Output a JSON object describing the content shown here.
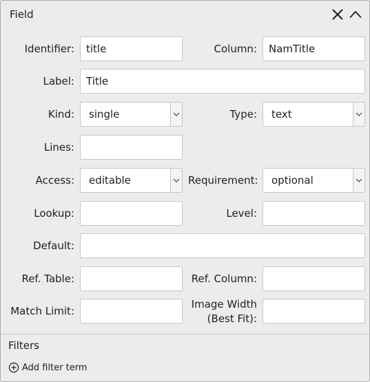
{
  "header": {
    "title": "Field"
  },
  "fields": {
    "identifier": {
      "label": "Identifier:",
      "value": "title"
    },
    "column": {
      "label": "Column:",
      "value": "NamTitle"
    },
    "label": {
      "label": "Label:",
      "value": "Title"
    },
    "kind": {
      "label": "Kind:",
      "value": "single"
    },
    "type": {
      "label": "Type:",
      "value": "text"
    },
    "lines": {
      "label": "Lines:",
      "value": ""
    },
    "access": {
      "label": "Access:",
      "value": "editable"
    },
    "requirement": {
      "label": "Requirement:",
      "value": "optional"
    },
    "lookup": {
      "label": "Lookup:",
      "value": ""
    },
    "level": {
      "label": "Level:",
      "value": ""
    },
    "default": {
      "label": "Default:",
      "value": ""
    },
    "ref_table": {
      "label": "Ref. Table:",
      "value": ""
    },
    "ref_column": {
      "label": "Ref. Column:",
      "value": ""
    },
    "match_limit": {
      "label": "Match Limit:",
      "value": ""
    },
    "image_width": {
      "label_line1": "Image Width",
      "label_line2": "(Best Fit):",
      "value": ""
    }
  },
  "filters": {
    "title": "Filters",
    "add_label": "Add filter term"
  },
  "icons": {
    "close": "close-icon",
    "collapse": "chevron-up-icon",
    "dropdown": "chevron-down-icon",
    "add": "plus-circle-icon"
  }
}
